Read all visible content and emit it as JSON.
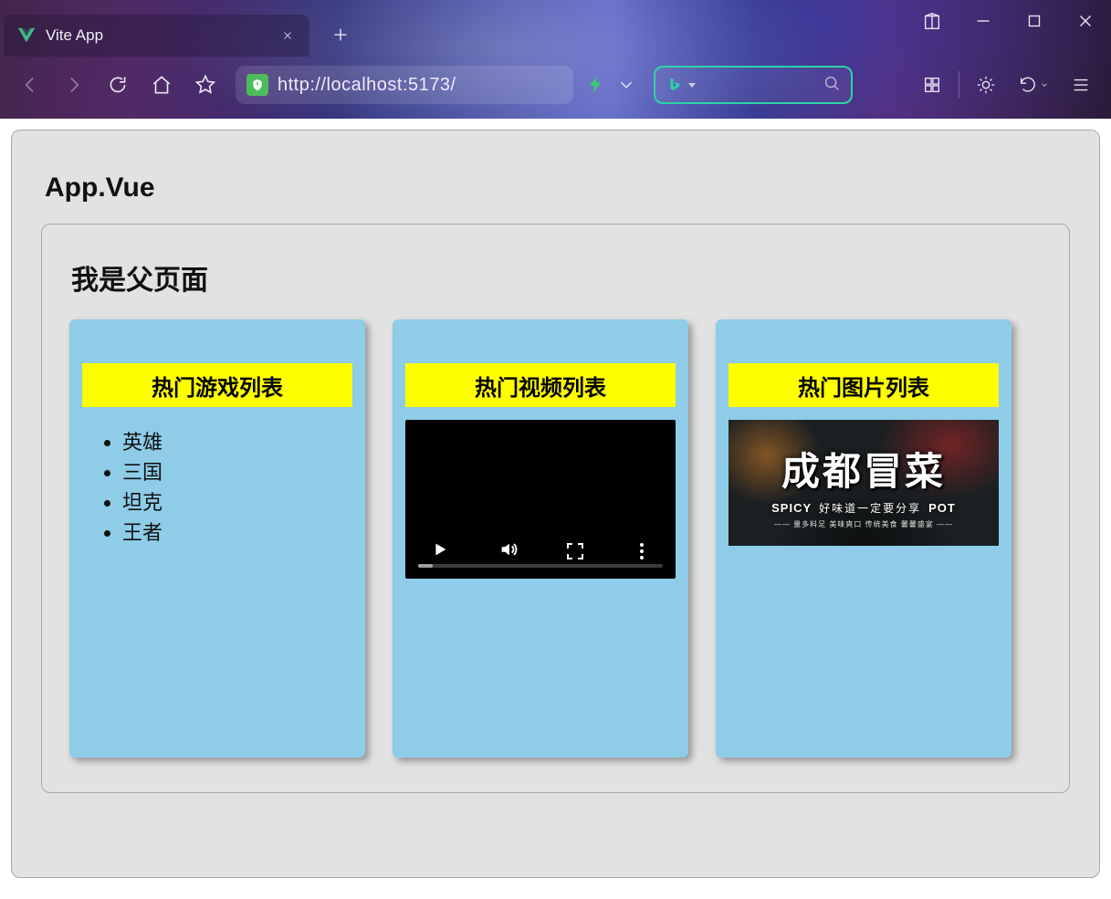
{
  "browser": {
    "tab_title": "Vite App",
    "url": "http://localhost:5173/"
  },
  "page": {
    "app_heading": "App.Vue",
    "parent_heading": "我是父页面",
    "cards": {
      "games": {
        "title": "热门游戏列表",
        "items": [
          "英雄",
          "三国",
          "坦克",
          "王者"
        ]
      },
      "videos": {
        "title": "热门视频列表"
      },
      "images": {
        "title": "热门图片列表",
        "banner": {
          "headline": "成都冒菜",
          "left_tag": "SPICY",
          "caption": "好味道一定要分享",
          "right_tag": "POT",
          "footnote": "—— 量多料足 美味爽口 传统美食 馨馨盛宴 ——"
        }
      }
    }
  }
}
